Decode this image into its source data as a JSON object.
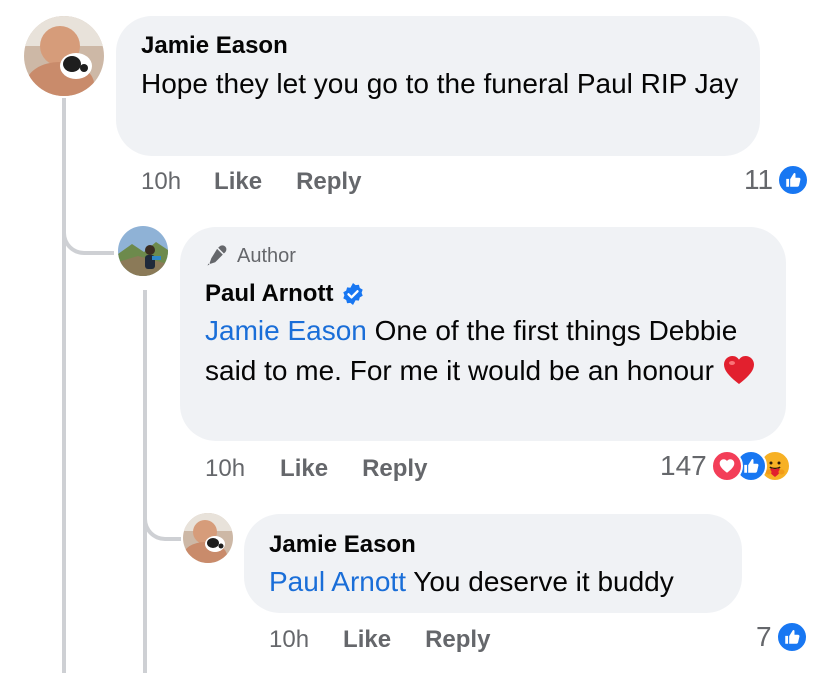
{
  "comments": [
    {
      "author": "Jamie Eason",
      "text": "Hope they let you go to the funeral Paul RIP Jay",
      "time": "10h",
      "like_label": "Like",
      "reply_label": "Reply",
      "reaction_count": "11",
      "reactions": [
        "like-icon"
      ]
    },
    {
      "badge": "Author",
      "author": "Paul Arnott",
      "verified": true,
      "mention": "Jamie Eason",
      "text": " One of the first things Debbie said to me. For me it would be an honour ",
      "emoji": "❤️",
      "time": "10h",
      "like_label": "Like",
      "reply_label": "Reply",
      "reaction_count": "147",
      "reactions": [
        "love-icon",
        "like-icon",
        "care-icon"
      ]
    },
    {
      "author": "Jamie Eason",
      "mention": "Paul Arnott",
      "text": " You deserve it buddy",
      "time": "10h",
      "like_label": "Like",
      "reply_label": "Reply",
      "reaction_count": "7",
      "reactions": [
        "like-icon"
      ]
    }
  ],
  "colors": {
    "bubble": "#f0f2f5",
    "mention": "#1a6ed8",
    "meta": "#65676b",
    "like": "#1877f2",
    "love": "#f33e58",
    "care": "#f7b125"
  }
}
